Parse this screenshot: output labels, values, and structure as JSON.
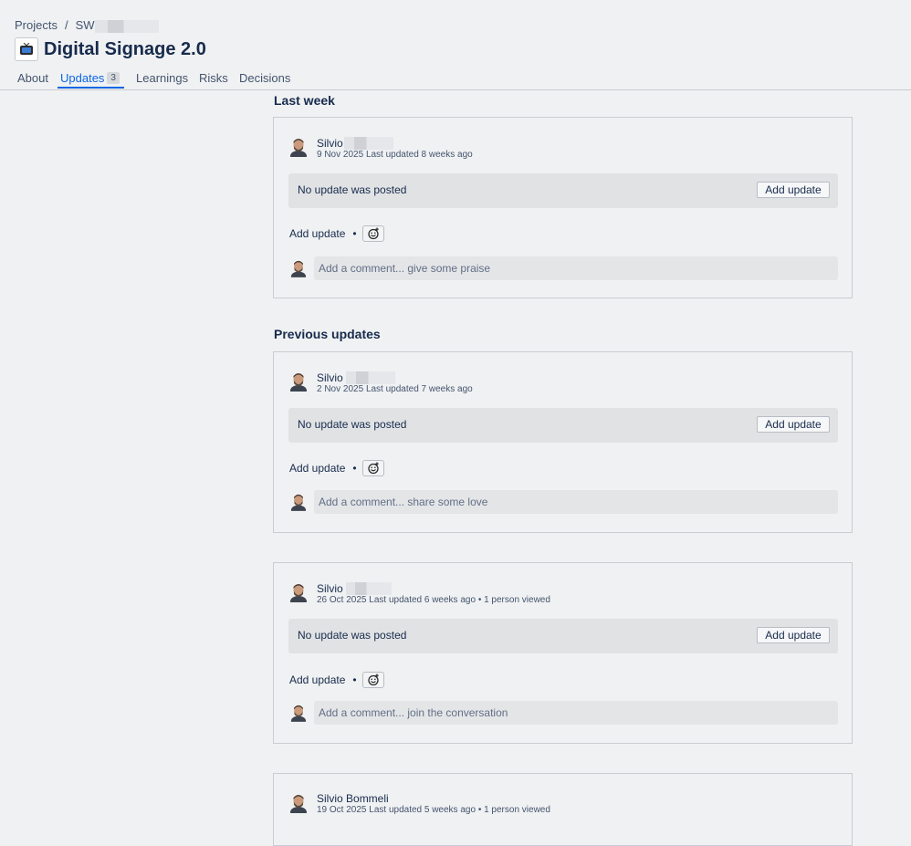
{
  "breadcrumb": {
    "root": "Projects",
    "separator": "/",
    "project_prefix": "SW"
  },
  "page": {
    "title": "Digital Signage 2.0"
  },
  "tabs": [
    {
      "label": "About"
    },
    {
      "label": "Updates",
      "count": "3"
    },
    {
      "label": "Learnings"
    },
    {
      "label": "Risks"
    },
    {
      "label": "Decisions"
    }
  ],
  "sections": {
    "last_week": "Last week",
    "previous": "Previous updates"
  },
  "updates": [
    {
      "author": "Silvio",
      "date": "9 Nov 2025",
      "updated": "Last updated 8 weeks ago",
      "viewed": "",
      "no_update": "No update was posted",
      "add_button": "Add update",
      "add_link": "Add update",
      "comment_placeholder": "Add a comment... give some praise"
    },
    {
      "author": "Silvio",
      "date": "2 Nov 2025",
      "updated": "Last updated 7 weeks ago",
      "viewed": "",
      "no_update": "No update was posted",
      "add_button": "Add update",
      "add_link": "Add update",
      "comment_placeholder": "Add a comment... share some love"
    },
    {
      "author": "Silvio",
      "date": "26 Oct 2025",
      "updated": "Last updated 6 weeks ago",
      "viewed": "• 1 person viewed",
      "no_update": "No update was posted",
      "add_button": "Add update",
      "add_link": "Add update",
      "comment_placeholder": "Add a comment... join the conversation"
    },
    {
      "author": "Silvio Bommeli",
      "date": "19 Oct 2025",
      "updated": "Last updated 5 weeks ago",
      "viewed": "• 1 person viewed"
    }
  ],
  "colors": {
    "accent": "#0c66e4",
    "background": "#f0f1f2",
    "card_border": "#c9ccd1",
    "panel": "#e1e2e4"
  },
  "icons": {
    "project": "tv-icon",
    "reaction": "add-reaction-icon",
    "avatar": "user-avatar"
  }
}
